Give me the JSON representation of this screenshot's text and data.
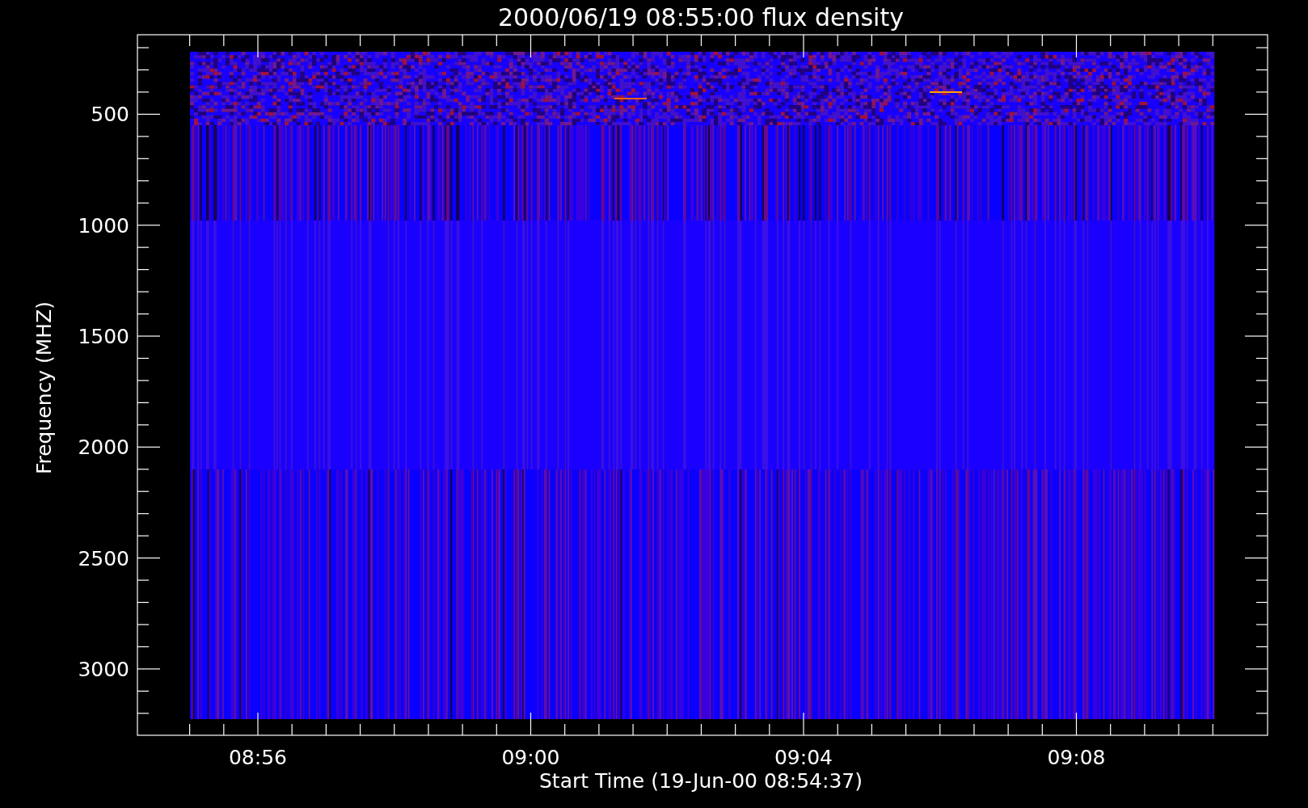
{
  "title": "2000/06/19 08:55:00 flux density",
  "y_axis": {
    "label": "Frequency (MHZ)",
    "ticks": [
      "500",
      "1000",
      "1500",
      "2000",
      "2500",
      "3000"
    ]
  },
  "x_axis": {
    "label": "Start Time (19-Jun-00 08:54:37)",
    "ticks": [
      "08:56",
      "09:00",
      "09:04",
      "09:08"
    ]
  }
}
